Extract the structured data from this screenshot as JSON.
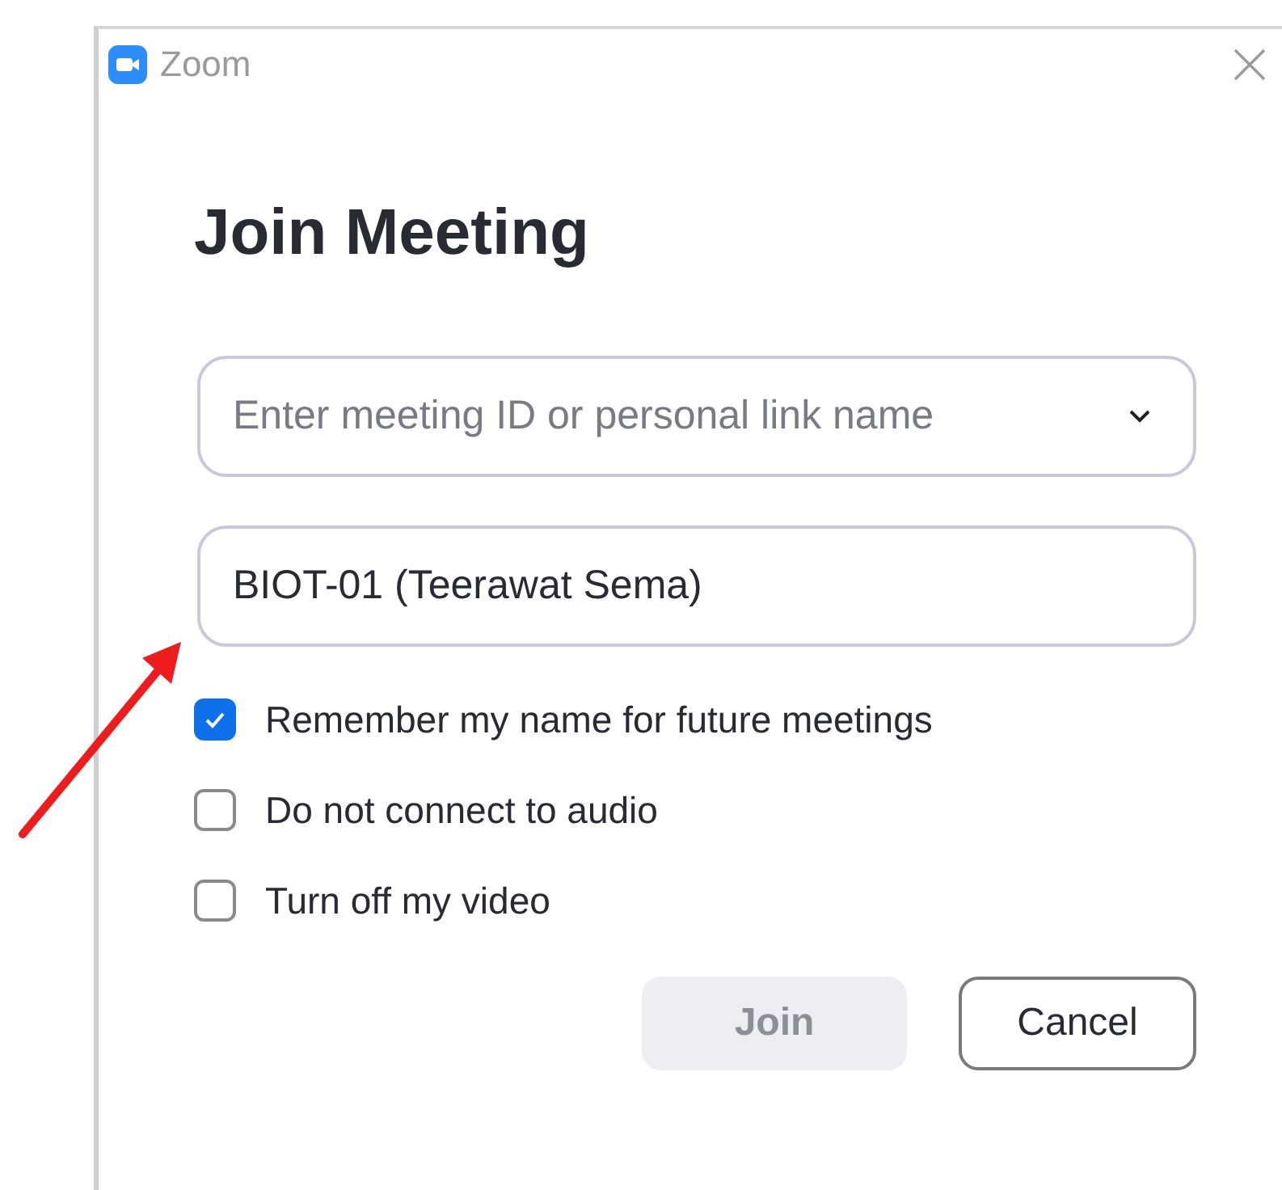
{
  "window": {
    "title": "Zoom"
  },
  "heading": "Join Meeting",
  "meeting_field": {
    "placeholder": "Enter meeting ID or personal link name"
  },
  "name_field": {
    "value": "BIOT-01 (Teerawat Sema)"
  },
  "options": [
    {
      "label": "Remember my name for future meetings",
      "checked": true
    },
    {
      "label": "Do not connect to audio",
      "checked": false
    },
    {
      "label": "Turn off my video",
      "checked": false
    }
  ],
  "buttons": [
    {
      "label": "Join",
      "kind": "primary",
      "disabled": true
    },
    {
      "label": "Cancel",
      "kind": "secondary",
      "disabled": false
    }
  ]
}
